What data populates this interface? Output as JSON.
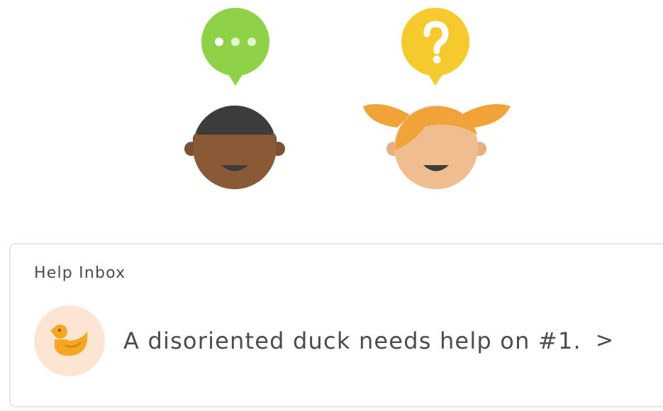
{
  "help_inbox": {
    "title": "Help Inbox",
    "message": "A disoriented duck needs help on #1.",
    "chevron": ">"
  },
  "icons": {
    "boy_bubble": "ellipsis-speech-bubble-icon",
    "girl_bubble": "question-speech-bubble-icon",
    "boy_avatar": "boy-avatar-icon",
    "girl_avatar": "girl-avatar-icon",
    "duck": "duck-icon"
  },
  "colors": {
    "green_bubble": "#8ed347",
    "yellow_bubble": "#f6c92d",
    "boy_skin": "#8a5a36",
    "boy_hair": "#3c3c3c",
    "girl_skin": "#f0bd8f",
    "girl_hair": "#f1a33a",
    "duck": "#f5a623",
    "duck_bg": "#fde6d1",
    "text": "#4b4b4b"
  }
}
